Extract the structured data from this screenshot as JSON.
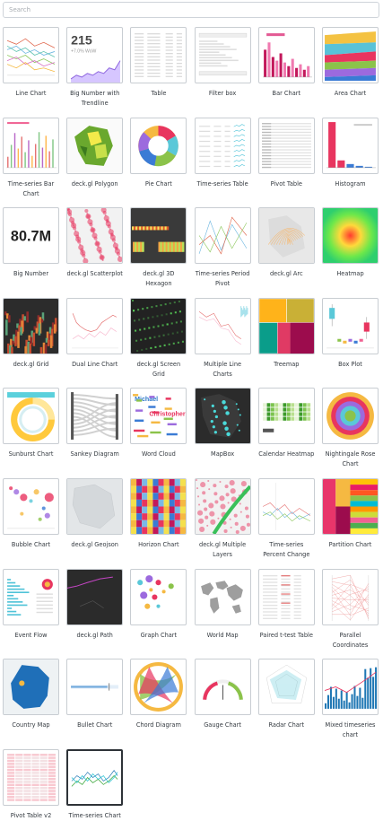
{
  "search": {
    "placeholder": "Search",
    "value": ""
  },
  "charts": [
    {
      "label": "Line Chart",
      "icon": "line-chart-thumbnail"
    },
    {
      "label": "Big Number with Trendline",
      "icon": "big-number-trendline-thumbnail",
      "thumb_text": "215",
      "thumb_subtext": "+7.0% WoW"
    },
    {
      "label": "Table",
      "icon": "table-thumbnail"
    },
    {
      "label": "Filter box",
      "icon": "filter-box-thumbnail"
    },
    {
      "label": "Bar Chart",
      "icon": "bar-chart-thumbnail"
    },
    {
      "label": "Area Chart",
      "icon": "area-chart-thumbnail"
    },
    {
      "label": "Time-series Bar Chart",
      "icon": "timeseries-bar-thumbnail"
    },
    {
      "label": "deck.gl Polygon",
      "icon": "deckgl-polygon-thumbnail"
    },
    {
      "label": "Pie Chart",
      "icon": "pie-chart-thumbnail"
    },
    {
      "label": "Time-series Table",
      "icon": "timeseries-table-thumbnail"
    },
    {
      "label": "Pivot Table",
      "icon": "pivot-table-thumbnail"
    },
    {
      "label": "Histogram",
      "icon": "histogram-thumbnail"
    },
    {
      "label": "Big Number",
      "icon": "big-number-thumbnail",
      "thumb_text": "80.7M"
    },
    {
      "label": "deck.gl Scatterplot",
      "icon": "deckgl-scatterplot-thumbnail"
    },
    {
      "label": "deck.gl 3D Hexagon",
      "icon": "deckgl-hexagon-thumbnail"
    },
    {
      "label": "Time-series Period Pivot",
      "icon": "timeseries-period-pivot-thumbnail"
    },
    {
      "label": "deck.gl Arc",
      "icon": "deckgl-arc-thumbnail"
    },
    {
      "label": "Heatmap",
      "icon": "heatmap-thumbnail"
    },
    {
      "label": "deck.gl Grid",
      "icon": "deckgl-grid-thumbnail"
    },
    {
      "label": "Dual Line Chart",
      "icon": "dual-line-thumbnail"
    },
    {
      "label": "deck.gl Screen Grid",
      "icon": "deckgl-screen-grid-thumbnail"
    },
    {
      "label": "Multiple Line Charts",
      "icon": "multiple-line-thumbnail"
    },
    {
      "label": "Treemap",
      "icon": "treemap-thumbnail"
    },
    {
      "label": "Box Plot",
      "icon": "box-plot-thumbnail"
    },
    {
      "label": "Sunburst Chart",
      "icon": "sunburst-thumbnail"
    },
    {
      "label": "Sankey Diagram",
      "icon": "sankey-thumbnail"
    },
    {
      "label": "Word Cloud",
      "icon": "word-cloud-thumbnail",
      "thumb_words": [
        "Michael",
        "Christopher"
      ]
    },
    {
      "label": "MapBox",
      "icon": "mapbox-thumbnail"
    },
    {
      "label": "Calendar Heatmap",
      "icon": "calendar-heatmap-thumbnail"
    },
    {
      "label": "Nightingale Rose Chart",
      "icon": "nightingale-rose-thumbnail"
    },
    {
      "label": "Bubble Chart",
      "icon": "bubble-chart-thumbnail"
    },
    {
      "label": "deck.gl Geojson",
      "icon": "deckgl-geojson-thumbnail"
    },
    {
      "label": "Horizon Chart",
      "icon": "horizon-chart-thumbnail"
    },
    {
      "label": "deck.gl Multiple Layers",
      "icon": "deckgl-multiple-layers-thumbnail"
    },
    {
      "label": "Time-series Percent Change",
      "icon": "timeseries-percent-change-thumbnail"
    },
    {
      "label": "Partition Chart",
      "icon": "partition-chart-thumbnail"
    },
    {
      "label": "Event Flow",
      "icon": "event-flow-thumbnail"
    },
    {
      "label": "deck.gl Path",
      "icon": "deckgl-path-thumbnail"
    },
    {
      "label": "Graph Chart",
      "icon": "graph-chart-thumbnail"
    },
    {
      "label": "World Map",
      "icon": "world-map-thumbnail"
    },
    {
      "label": "Paired t-test Table",
      "icon": "paired-ttest-thumbnail"
    },
    {
      "label": "Parallel Coordinates",
      "icon": "parallel-coordinates-thumbnail"
    },
    {
      "label": "Country Map",
      "icon": "country-map-thumbnail"
    },
    {
      "label": "Bullet Chart",
      "icon": "bullet-chart-thumbnail"
    },
    {
      "label": "Chord Diagram",
      "icon": "chord-diagram-thumbnail"
    },
    {
      "label": "Gauge Chart",
      "icon": "gauge-chart-thumbnail"
    },
    {
      "label": "Radar Chart",
      "icon": "radar-chart-thumbnail"
    },
    {
      "label": "Mixed timeseries chart",
      "icon": "mixed-timeseries-thumbnail"
    },
    {
      "label": "Pivot Table v2",
      "icon": "pivot-table-v2-thumbnail"
    },
    {
      "label": "Time-series Chart",
      "icon": "timeseries-chart-thumbnail",
      "selected": true
    }
  ]
}
